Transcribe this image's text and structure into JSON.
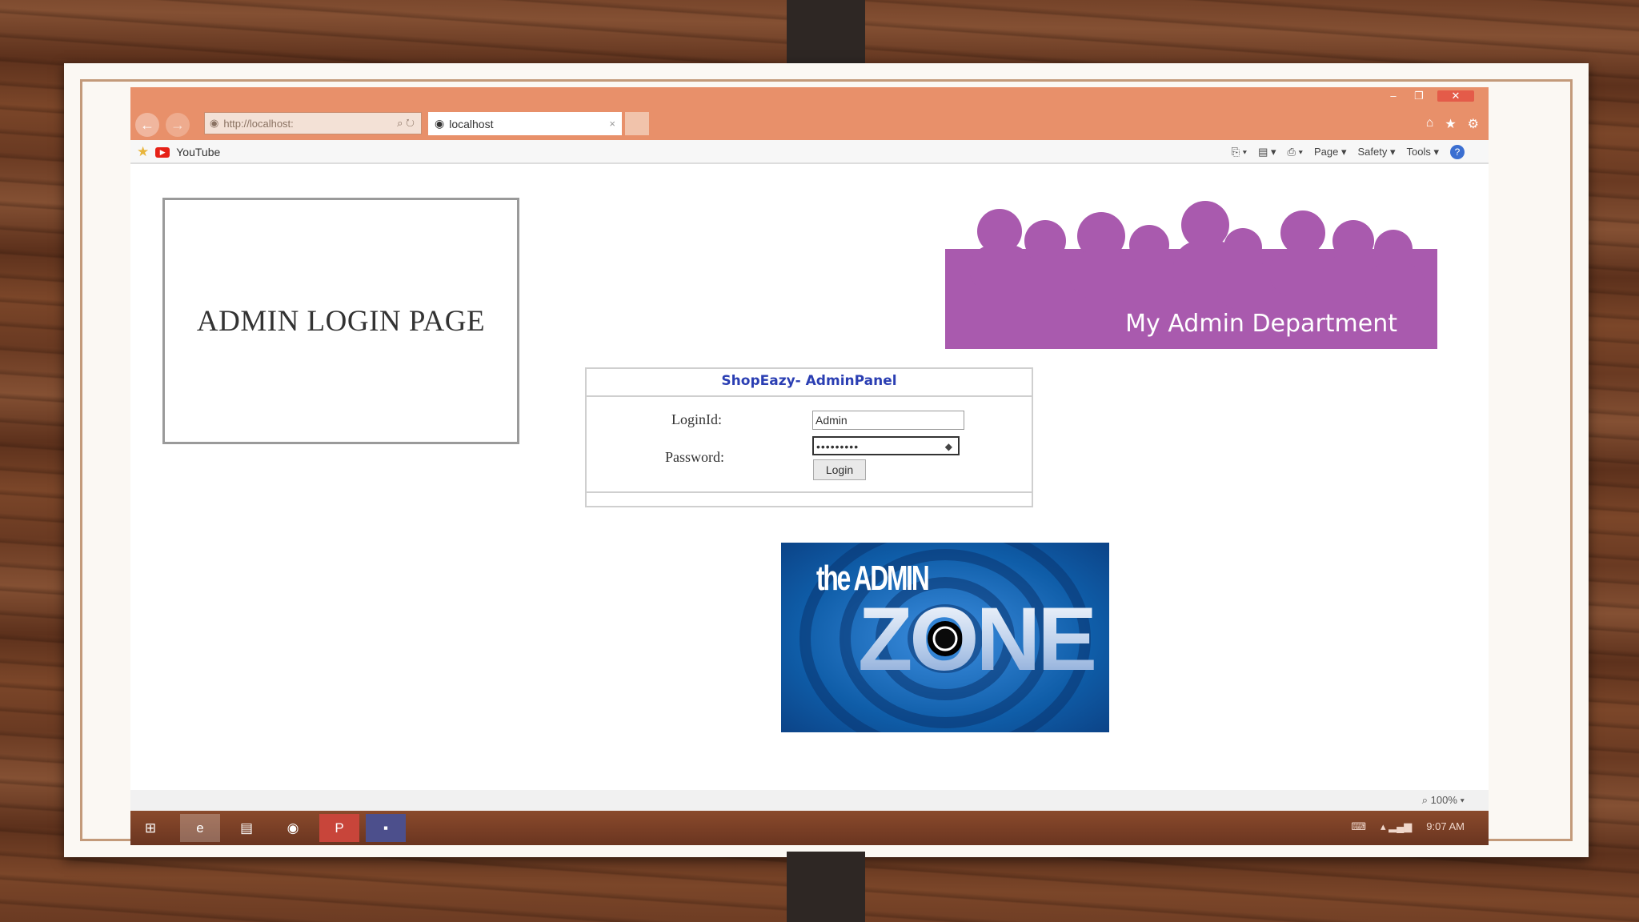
{
  "browser": {
    "address": "http://localhost:",
    "address_host": "localhost",
    "tab_title": "localhost",
    "tab_close": "×",
    "favorites": [
      "YouTube"
    ],
    "commands": [
      "Page ▾",
      "Safety ▾",
      "Tools ▾"
    ],
    "zoom": "100%"
  },
  "page": {
    "admin_title": "ADMIN LOGIN PAGE",
    "banner_text": "My Admin Department",
    "panel_title": "ShopEazy- AdminPanel",
    "login_label": "LoginId:",
    "login_value": "Admin",
    "password_label": "Password:",
    "password_value": "•••••••••",
    "login_button": "Login",
    "zone_small": "the ADMIN",
    "zone_big": "ZONE"
  },
  "taskbar": {
    "time": "9:07 AM"
  },
  "colors": {
    "titlebar": "#e8906a",
    "banner": "#a95aae",
    "panel_title": "#2b3fb3",
    "zone_bg": "#0f5da8"
  }
}
